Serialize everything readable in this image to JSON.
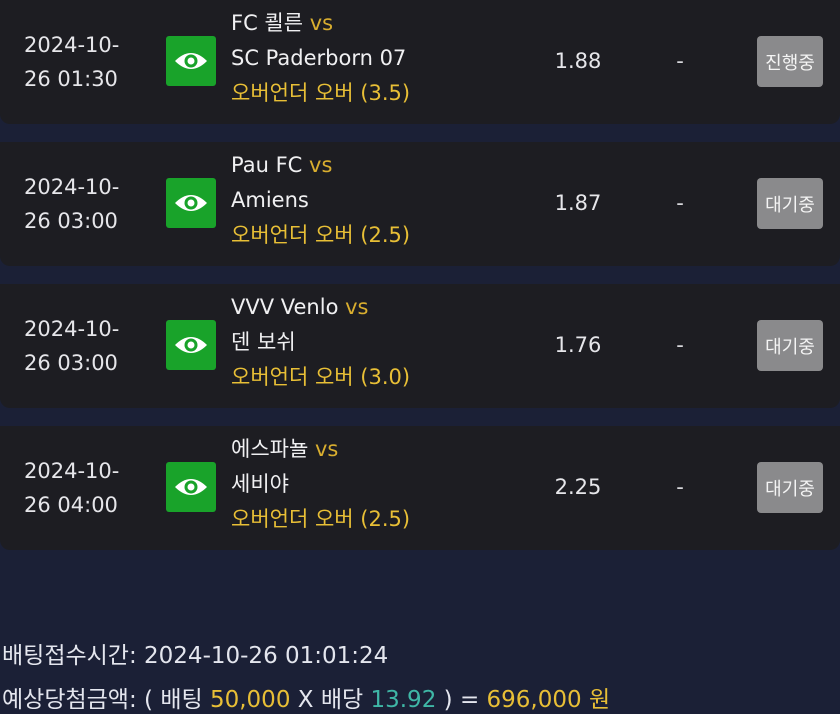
{
  "bets": [
    {
      "date_line1": "2024-10-",
      "date_line2": "26 01:30",
      "home": "FC 쾰른",
      "vs": "vs",
      "away": "SC Paderborn 07",
      "market": "오버언더 오버 (3.5)",
      "odds": "1.88",
      "result": "-",
      "status": "진행중"
    },
    {
      "date_line1": "2024-10-",
      "date_line2": "26 03:00",
      "home": "Pau FC",
      "vs": "vs",
      "away": "Amiens",
      "market": "오버언더 오버 (2.5)",
      "odds": "1.87",
      "result": "-",
      "status": "대기중"
    },
    {
      "date_line1": "2024-10-",
      "date_line2": "26 03:00",
      "home": "VVV Venlo",
      "vs": "vs",
      "away": "덴 보쉬",
      "market": "오버언더 오버 (3.0)",
      "odds": "1.76",
      "result": "-",
      "status": "대기중"
    },
    {
      "date_line1": "2024-10-",
      "date_line2": "26 04:00",
      "home": "에스파뇰",
      "vs": "vs",
      "away": "세비야",
      "market": "오버언더 오버 (2.5)",
      "odds": "2.25",
      "result": "-",
      "status": "대기중"
    }
  ],
  "footer": {
    "bet_time_label": "배팅접수시간:",
    "bet_time_value": "2024-10-26 01:01:24",
    "payout_label": "예상당첨금액:",
    "open_paren": "(",
    "stake_label": "배팅",
    "stake_value": "50,000",
    "times": "X",
    "odds_label": "배당",
    "odds_value": "13.92",
    "close_eq": ") =",
    "payout_value": "696,000",
    "currency": "원"
  },
  "colors": {
    "background": "#1b2036",
    "card": "#1d1d22",
    "eye_button": "#19a32a",
    "status_button": "#8a8a8c",
    "market_text": "#e8bf36",
    "teal_value": "#3fb7a6"
  },
  "icons": {
    "detail_button": "eye-icon"
  }
}
